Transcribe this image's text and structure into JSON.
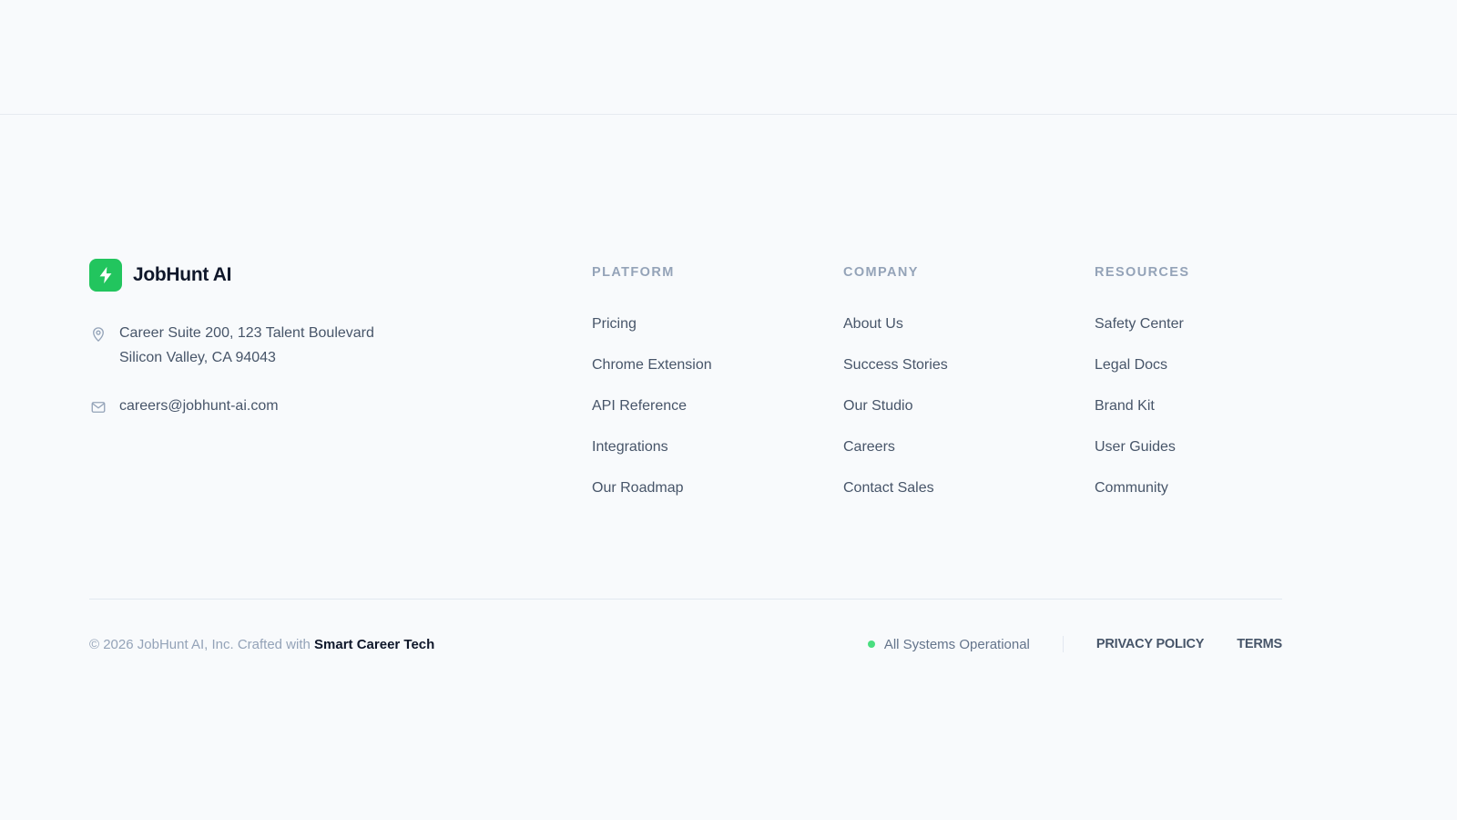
{
  "brand": {
    "name": "JobHunt AI",
    "accent_color": "#22c55e",
    "logo_icon": "lightning-bolt-icon"
  },
  "contact": {
    "address_icon": "map-pin-icon",
    "address_line1": "Career Suite 200, 123 Talent Boulevard",
    "address_line2": "Silicon Valley, CA 94043",
    "email_icon": "mail-icon",
    "email": "careers@jobhunt-ai.com"
  },
  "columns": [
    {
      "title": "PLATFORM",
      "links": [
        "Pricing",
        "Chrome Extension",
        "API Reference",
        "Integrations",
        "Our Roadmap"
      ]
    },
    {
      "title": "COMPANY",
      "links": [
        "About Us",
        "Success Stories",
        "Our Studio",
        "Careers",
        "Contact Sales"
      ]
    },
    {
      "title": "RESOURCES",
      "links": [
        "Safety Center",
        "Legal Docs",
        "Brand Kit",
        "User Guides",
        "Community"
      ]
    }
  ],
  "bottom": {
    "copyright_prefix": "© 2026 JobHunt AI, Inc. Crafted with ",
    "copyright_highlight": "Smart Career Tech",
    "status_text": "All Systems Operational",
    "status_color": "#4ade80",
    "privacy_label": "PRIVACY POLICY",
    "terms_label": "TERMS"
  }
}
